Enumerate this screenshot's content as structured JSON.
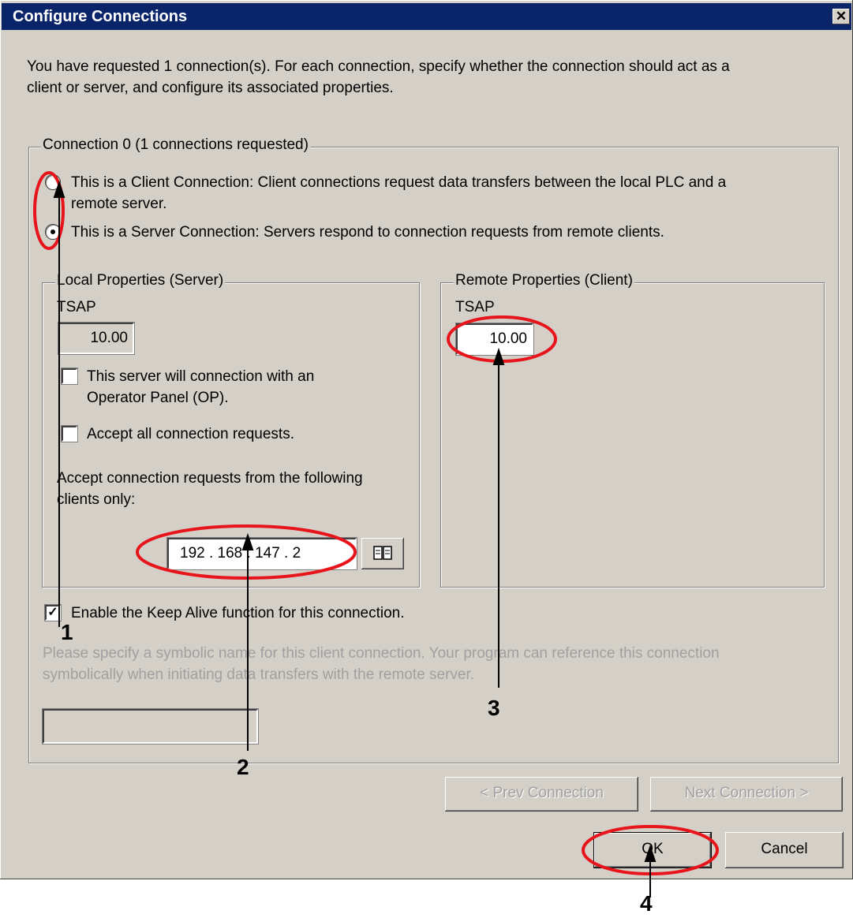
{
  "window": {
    "title": "Configure Connections",
    "close_glyph": "✕"
  },
  "intro": {
    "line1": "You have requested 1 connection(s).  For each connection, specify whether the connection should act as a",
    "line2": "client or server, and configure its associated properties."
  },
  "connection_group": {
    "legend": "Connection 0 (1 connections requested)",
    "client_radio": {
      "line1": "This is a Client Connection: Client connections request data transfers between the local PLC and a",
      "line2": "remote server.",
      "selected": false
    },
    "server_radio": {
      "label": "This is a Server Connection: Servers respond to connection requests from remote clients.",
      "selected": true
    }
  },
  "local_props": {
    "legend": "Local Properties (Server)",
    "tsap_label": "TSAP",
    "tsap_value": "10.00",
    "op_checkbox": {
      "line1": "This server will connection with an",
      "line2": "Operator Panel (OP).",
      "checked": false
    },
    "accept_all_checkbox": {
      "label": "Accept all connection requests.",
      "checked": false
    },
    "clients_label_line1": "Accept connection requests from the following",
    "clients_label_line2": "clients only:",
    "ip_value": "192 . 168 . 147 .  2",
    "address_book_icon": "address-book-icon"
  },
  "remote_props": {
    "legend": "Remote Properties (Client)",
    "tsap_label": "TSAP",
    "tsap_value": "10.00"
  },
  "keep_alive": {
    "label": "Enable the Keep Alive function for this connection.",
    "checked": true,
    "check_glyph": "✓"
  },
  "symbolic": {
    "line1": "Please specify a symbolic name for this client connection.  Your program can reference this connection",
    "line2": "symbolically when initiating data transfers with the remote server.",
    "value": ""
  },
  "buttons": {
    "prev": "< Prev Connection",
    "next": "Next Connection >",
    "ok": "OK",
    "cancel": "Cancel"
  },
  "annotations": {
    "n1": "1",
    "n2": "2",
    "n3": "3",
    "n4": "4"
  },
  "colors": {
    "annotation": "#e8141c",
    "title_bar": "#0a246a",
    "dialog": "#d4d0c8"
  }
}
